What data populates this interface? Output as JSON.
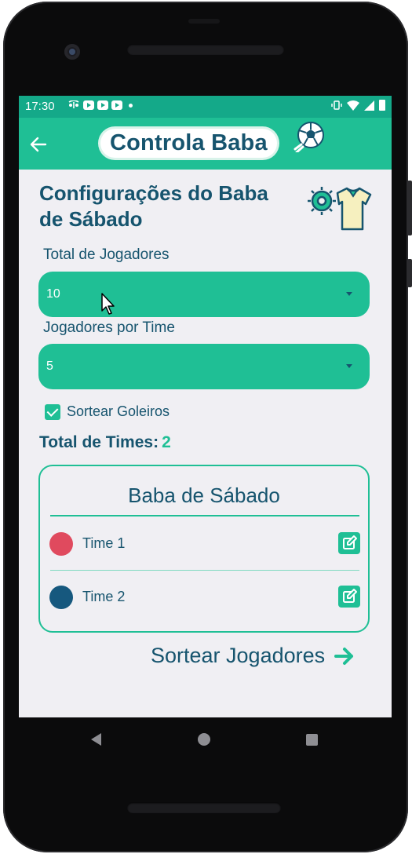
{
  "status_bar": {
    "time": "17:30",
    "notification_icons": [
      "bluetooth-share-icon",
      "youtube-icon",
      "youtube-icon",
      "youtube-icon"
    ],
    "system_icons": [
      "vibrate-icon",
      "wifi-icon",
      "signal-icon",
      "battery-icon"
    ]
  },
  "app_bar": {
    "logo_text": "Controla Baba",
    "back_icon": "arrow-left-icon"
  },
  "page": {
    "title": "Configurações do Baba de Sábado"
  },
  "form": {
    "total_players": {
      "label": "Total de Jogadores",
      "value": "10"
    },
    "players_per_team": {
      "label": "Jogadores por Time",
      "value": "5"
    },
    "sort_goalkeepers": {
      "label": "Sortear Goleiros",
      "checked": true
    }
  },
  "summary": {
    "total_teams_label": "Total de Times:",
    "total_teams_value": "2"
  },
  "teams_card": {
    "title": "Baba de Sábado",
    "teams": [
      {
        "name": "Time 1",
        "color": "#e04a5e"
      },
      {
        "name": "Time 2",
        "color": "#16587e"
      }
    ]
  },
  "actions": {
    "sort_players_label": "Sortear Jogadores"
  },
  "colors": {
    "primary": "#1fbf95",
    "status_bar": "#14a989",
    "text_dark": "#16546e",
    "background": "#f0eff3"
  }
}
